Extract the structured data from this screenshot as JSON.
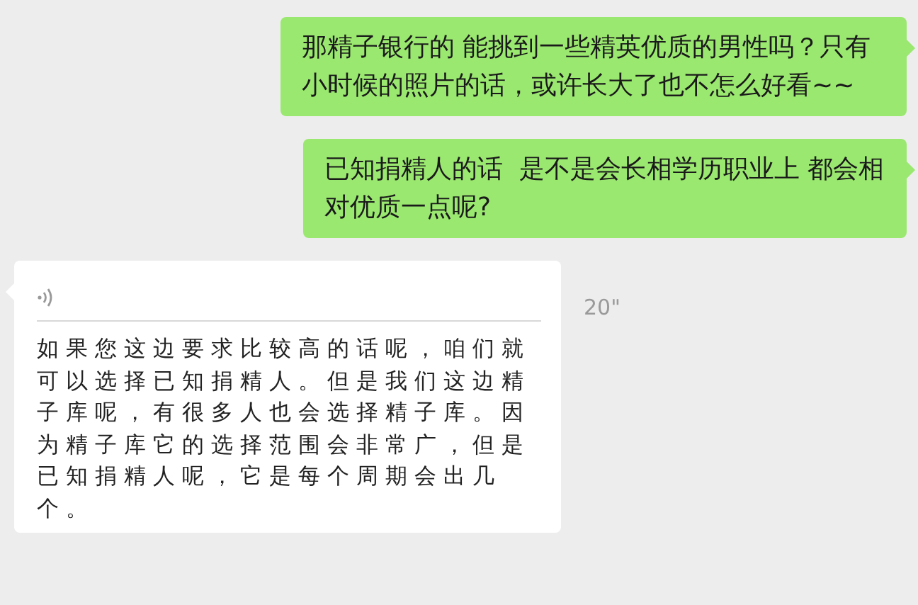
{
  "messages": [
    {
      "kind": "sent_text",
      "text": "那精子银行的 能挑到一些精英优质的男性吗？只有小时候的照片的话，或许长大了也不怎么好看~~"
    },
    {
      "kind": "sent_text",
      "text": "已知捐精人的话  是不是会长相学历职业上 都会相对优质一点呢?"
    },
    {
      "kind": "received_voice",
      "duration": "20\"",
      "transcript": "如果您这边要求比较高的话呢，咱们就可以选择已知捐精人。但是我们这边精子库呢，有很多人也会选择精子库。因为精子库它的选择范围会非常广，但是已知捐精人呢，它是每个周期会出几个。"
    }
  ]
}
